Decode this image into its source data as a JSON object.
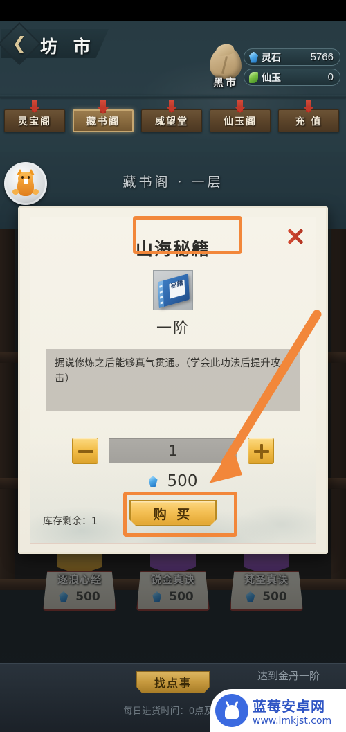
{
  "header": {
    "back_icon": "chevron-left-icon",
    "title": "坊  市",
    "blackmarket_label": "黑市",
    "blackmarket_icon": "sack-icon",
    "currencies": [
      {
        "icon": "blue-gem-icon",
        "name": "灵石",
        "value": "5766"
      },
      {
        "icon": "green-jade-icon",
        "name": "仙玉",
        "value": "0"
      }
    ]
  },
  "tabs": [
    {
      "label": "灵宝阁",
      "active": false
    },
    {
      "label": "藏书阁",
      "active": true
    },
    {
      "label": "威望堂",
      "active": false
    },
    {
      "label": "仙玉阁",
      "active": false
    },
    {
      "label": "充 值",
      "active": false
    }
  ],
  "section": {
    "label": "藏书阁 · 一层"
  },
  "avatar": {
    "icon": "fox-avatar-icon"
  },
  "dialog": {
    "title": "山海秘籍",
    "close_icon": "close-x-icon",
    "item_icon": "blue-book-icon",
    "item_icon_text": "秘籍",
    "tier": "一阶",
    "description": "据说修炼之后能够真气贯通。（学会此功法后提升攻击）",
    "stepper": {
      "minus_icon": "minus-icon",
      "plus_icon": "plus-icon",
      "quantity": "1"
    },
    "price": {
      "icon": "blue-gem-icon",
      "value": "500"
    },
    "buy_label": "购 买",
    "stock_text": "库存剩余：1"
  },
  "shelf_items": [
    {
      "name": "逐浪心经",
      "price": "500",
      "banner": "gold"
    },
    {
      "name": "锐金真诀",
      "price": "500",
      "banner": "purple"
    },
    {
      "name": "梵圣真诀",
      "price": "500",
      "banner": "purple"
    }
  ],
  "bottom": {
    "action_label": "找点事",
    "restock_text": "每日进货时间：0点及…",
    "goal_text": "达到金丹一阶"
  },
  "watermark": {
    "title": "蓝莓安卓网",
    "url": "www.lmkjst.com",
    "icon": "android-robot-icon"
  },
  "annotations": {
    "title_box": "highlight-title",
    "buy_box": "highlight-buy-button",
    "arrow": "arrow-to-buy-button",
    "color": "#f2873a"
  }
}
